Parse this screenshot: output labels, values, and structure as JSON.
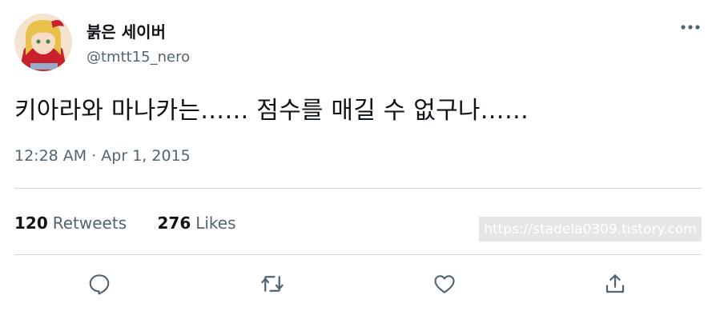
{
  "user": {
    "display_name": "붉은 세이버",
    "handle": "@tmtt15_nero",
    "avatar_icon": "profile-avatar"
  },
  "more_icon": "more-horizontal-icon",
  "tweet": {
    "text": "키아라와 마나카는…… 점수를 매길 수 없구나……",
    "timestamp": "12:28 AM · Apr 1, 2015"
  },
  "stats": {
    "retweets_count": "120",
    "retweets_label": "Retweets",
    "likes_count": "276",
    "likes_label": "Likes"
  },
  "watermark": "https://stadela0309.tistory.com",
  "actions": {
    "reply_icon": "reply-icon",
    "retweet_icon": "retweet-icon",
    "like_icon": "heart-icon",
    "share_icon": "share-icon"
  },
  "colors": {
    "text_primary": "#0f1419",
    "text_secondary": "#536471",
    "divider": "#cfd9de",
    "icon": "#536471"
  }
}
